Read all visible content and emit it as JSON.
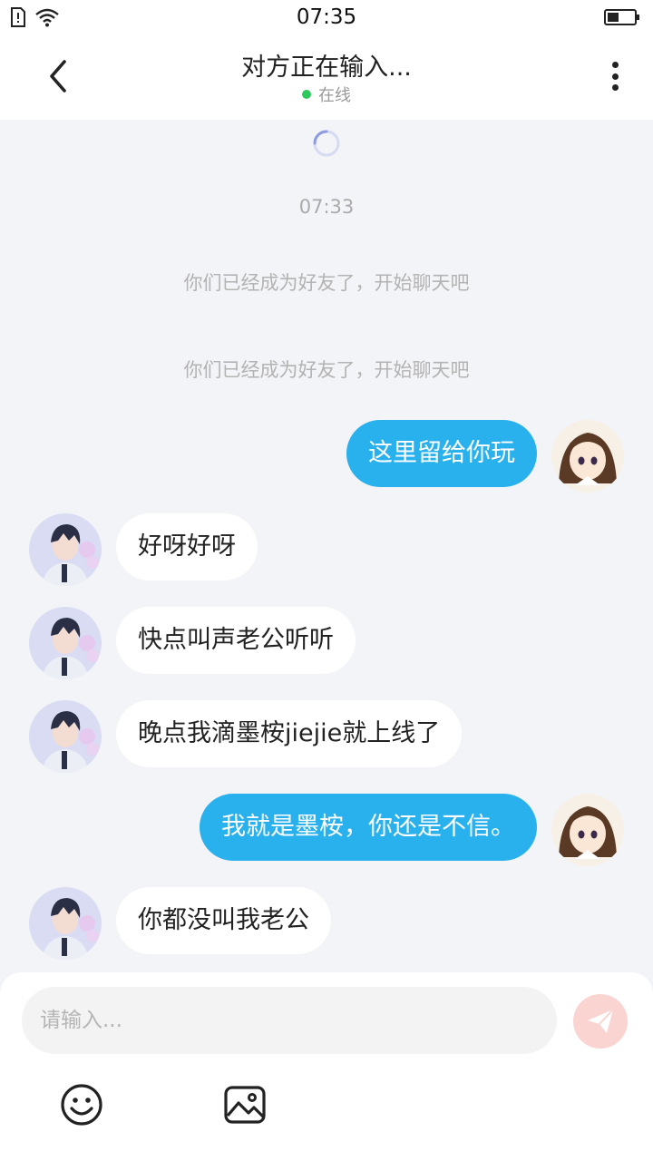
{
  "status_bar": {
    "time": "07:35"
  },
  "header": {
    "title": "对方正在输入...",
    "status": "在线"
  },
  "chat": {
    "timestamp": "07:33",
    "system_messages": [
      "你们已经成为好友了，开始聊天吧",
      "你们已经成为好友了，开始聊天吧"
    ],
    "messages": [
      {
        "side": "right",
        "text": "这里留给你玩"
      },
      {
        "side": "left",
        "text": "好呀好呀"
      },
      {
        "side": "left",
        "text": "快点叫声老公听听"
      },
      {
        "side": "left",
        "text": "晚点我滴墨桉jiejie就上线了"
      },
      {
        "side": "right",
        "text": "我就是墨桉，你还是不信。"
      },
      {
        "side": "left",
        "text": "你都没叫我老公"
      }
    ]
  },
  "composer": {
    "placeholder": "请输入..."
  },
  "colors": {
    "self_bubble": "#29b1ee",
    "other_bubble": "#ffffff",
    "online": "#2fc85a",
    "send_button": "#fad4d0"
  }
}
